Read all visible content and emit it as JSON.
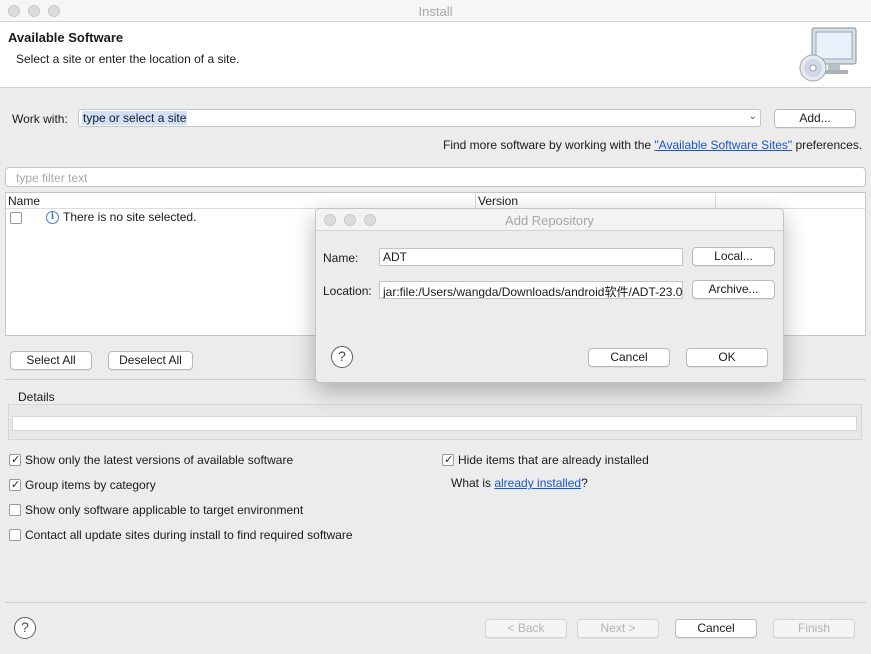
{
  "window": {
    "title": "Install"
  },
  "header": {
    "title": "Available Software",
    "subtitle": "Select a site or enter the location of a site."
  },
  "work_with": {
    "label": "Work with:",
    "value": "type or select a site",
    "add_button": "Add..."
  },
  "find_more": {
    "prefix": "Find more software by working with the ",
    "link": "\"Available Software Sites\"",
    "suffix": " preferences."
  },
  "filter": {
    "placeholder": "type filter text"
  },
  "table": {
    "columns": [
      "Name",
      "Version"
    ],
    "empty_message": "There is no site selected."
  },
  "selection_buttons": {
    "select_all": "Select All",
    "deselect_all": "Deselect All"
  },
  "details": {
    "label": "Details"
  },
  "options": {
    "show_latest": {
      "label": "Show only the latest versions of available software",
      "checked": true
    },
    "group_by_category": {
      "label": "Group items by category",
      "checked": true
    },
    "target_env": {
      "label": "Show only software applicable to target environment",
      "checked": false
    },
    "contact_all": {
      "label": "Contact all update sites during install to find required software",
      "checked": false
    },
    "hide_installed": {
      "label": "Hide items that are already installed",
      "checked": true
    },
    "what_is_prefix": "What is ",
    "what_is_link": "already installed",
    "what_is_suffix": "?"
  },
  "footer": {
    "back": "< Back",
    "next": "Next >",
    "cancel": "Cancel",
    "finish": "Finish"
  },
  "dialog": {
    "title": "Add Repository",
    "name_label": "Name:",
    "name_value": "ADT",
    "location_label": "Location:",
    "location_value": "jar:file:/Users/wangda/Downloads/android软件/ADT-23.0",
    "local_button": "Local...",
    "archive_button": "Archive...",
    "cancel_button": "Cancel",
    "ok_button": "OK"
  },
  "icons": {
    "help": "help-icon",
    "info": "info-icon",
    "install_banner": "computer-cd-icon"
  }
}
